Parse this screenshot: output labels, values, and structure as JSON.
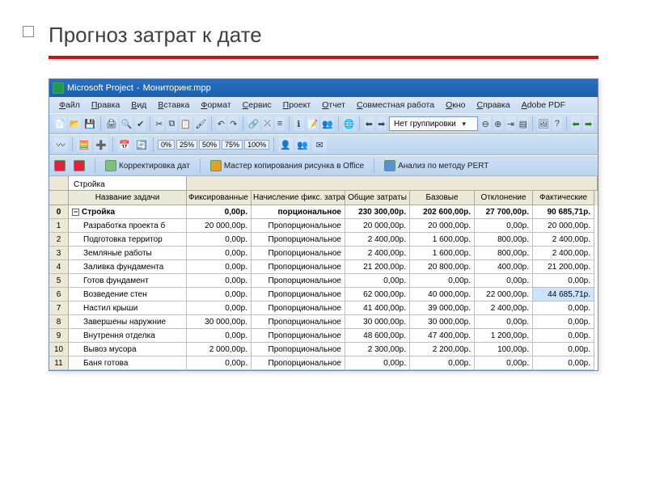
{
  "slide": {
    "title": "Прогноз затрат к дате"
  },
  "titlebar": {
    "app": "Microsoft Project",
    "file": "Мониторинг.mpp"
  },
  "menu": [
    "Файл",
    "Правка",
    "Вид",
    "Вставка",
    "Формат",
    "Сервис",
    "Проект",
    "Отчет",
    "Совместная работа",
    "Окно",
    "Справка",
    "Adobe PDF"
  ],
  "toolbar": {
    "grouping_label": "Нет группировки",
    "zoom_pcts": [
      "0%",
      "25%",
      "50%",
      "75%",
      "100%"
    ],
    "link1": "Корректировка дат",
    "link2": "Мастер копирования рисунка в Office",
    "link3": "Анализ по методу PERT",
    "icons": {
      "new": "new",
      "open": "open",
      "save": "save",
      "print": "print",
      "preview": "preview",
      "spell": "spell",
      "cut": "cut",
      "copy": "copy",
      "paste": "paste",
      "undo": "undo",
      "redo": "redo",
      "link": "link",
      "unlink": "unlink",
      "split": "split",
      "info": "info",
      "wizard": "wizard",
      "img": "img",
      "grpminus": "-",
      "grpplus": "+",
      "zoomout": "zoomout",
      "zoomin": "zoomin",
      "goto": "goto",
      "ganttzoom": "ganttzoom",
      "back": "back",
      "fwd": "fwd",
      "pdf1": "pdf",
      "pdf2": "pdf",
      "pane": "pane",
      "wave": "wave",
      "tool": "tool"
    }
  },
  "sheet": {
    "super_header": "Стройка",
    "columns": [
      "Название задачи",
      "Фиксированные затраты",
      "Начисление фикс. затрат",
      "Общие затраты",
      "Базовые",
      "Отклонение",
      "Фактические"
    ],
    "rows": [
      {
        "n": "0",
        "name": "Стройка",
        "indent": 0,
        "expander": true,
        "bold": true,
        "fix": "0,00р.",
        "charge": "порциональное",
        "total": "230 300,00р.",
        "base": "202 600,00р.",
        "dev": "27 700,00р.",
        "fact": "90 685,71р.",
        "hi": false
      },
      {
        "n": "1",
        "name": "Разработка проекта б",
        "indent": 1,
        "fix": "20 000,00р.",
        "charge": "Пропорциональное",
        "total": "20 000,00р.",
        "base": "20 000,00р.",
        "dev": "0,00р.",
        "fact": "20 000,00р.",
        "hi": false
      },
      {
        "n": "2",
        "name": "Подготовка территор",
        "indent": 1,
        "fix": "0,00р.",
        "charge": "Пропорциональное",
        "total": "2 400,00р.",
        "base": "1 600,00р.",
        "dev": "800,00р.",
        "fact": "2 400,00р.",
        "hi": false
      },
      {
        "n": "3",
        "name": "Земляные работы",
        "indent": 1,
        "fix": "0,00р.",
        "charge": "Пропорциональное",
        "total": "2 400,00р.",
        "base": "1 600,00р.",
        "dev": "800,00р.",
        "fact": "2 400,00р.",
        "hi": false
      },
      {
        "n": "4",
        "name": "Заливка фундамента",
        "indent": 1,
        "fix": "0,00р.",
        "charge": "Пропорциональное",
        "total": "21 200,00р.",
        "base": "20 800,00р.",
        "dev": "400,00р.",
        "fact": "21 200,00р.",
        "hi": false
      },
      {
        "n": "5",
        "name": "Готов фундамент",
        "indent": 1,
        "fix": "0,00р.",
        "charge": "Пропорциональное",
        "total": "0,00р.",
        "base": "0,00р.",
        "dev": "0,00р.",
        "fact": "0,00р.",
        "hi": false
      },
      {
        "n": "6",
        "name": "Возведение стен",
        "indent": 1,
        "fix": "0,00р.",
        "charge": "Пропорциональное",
        "total": "62 000,00р.",
        "base": "40 000,00р.",
        "dev": "22 000,00р.",
        "fact": "44 685,71р.",
        "hi": true
      },
      {
        "n": "7",
        "name": "Настил крыши",
        "indent": 1,
        "fix": "0,00р.",
        "charge": "Пропорциональное",
        "total": "41 400,00р.",
        "base": "39 000,00р.",
        "dev": "2 400,00р.",
        "fact": "0,00р.",
        "hi": false
      },
      {
        "n": "8",
        "name": "Завершены наружние",
        "indent": 1,
        "fix": "30 000,00р.",
        "charge": "Пропорциональное",
        "total": "30 000,00р.",
        "base": "30 000,00р.",
        "dev": "0,00р.",
        "fact": "0,00р.",
        "hi": false
      },
      {
        "n": "9",
        "name": "Внутрення отделка",
        "indent": 1,
        "fix": "0,00р.",
        "charge": "Пропорциональное",
        "total": "48 600,00р.",
        "base": "47 400,00р.",
        "dev": "1 200,00р.",
        "fact": "0,00р.",
        "hi": false
      },
      {
        "n": "10",
        "name": "Вывоз мусора",
        "indent": 1,
        "fix": "2 000,00р.",
        "charge": "Пропорциональное",
        "total": "2 300,00р.",
        "base": "2 200,00р.",
        "dev": "100,00р.",
        "fact": "0,00р.",
        "hi": false
      },
      {
        "n": "11",
        "name": "Баня готова",
        "indent": 1,
        "fix": "0,00р.",
        "charge": "Пропорциональное",
        "total": "0,00р.",
        "base": "0,00р.",
        "dev": "0,00р.",
        "fact": "0,00р.",
        "hi": false
      }
    ]
  }
}
